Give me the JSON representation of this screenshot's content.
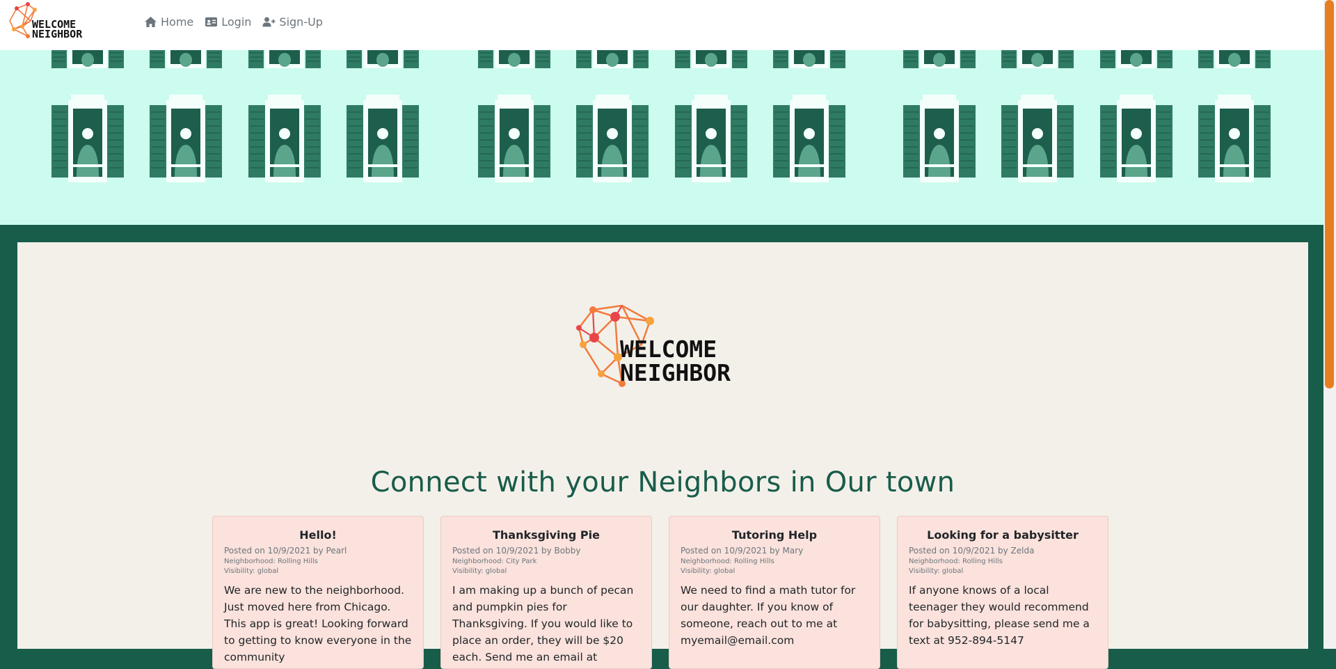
{
  "nav": {
    "logo_text": [
      "WELCOME",
      "NEIGHBOR"
    ],
    "links": [
      {
        "label": "Home",
        "icon": "home-icon"
      },
      {
        "label": "Login",
        "icon": "id-card-icon"
      },
      {
        "label": "Sign-Up",
        "icon": "user-plus-icon"
      }
    ]
  },
  "main": {
    "logo_text": [
      "WELCOME",
      "NEIGHBOR"
    ],
    "headline": "Connect with your Neighbors in Our town",
    "posts": [
      {
        "title": "Hello!",
        "posted": "Posted on 10/9/2021 by Pearl",
        "neighborhood": "Neighborhood: Rolling Hills",
        "visibility": "Visibility: global",
        "body": "We are new to the neighborhood. Just moved here from Chicago. This app is great! Looking forward to getting to know everyone in the community"
      },
      {
        "title": "Thanksgiving Pie",
        "posted": "Posted on 10/9/2021 by Bobby",
        "neighborhood": "Neighborhood: City Park",
        "visibility": "Visibility: global",
        "body": "I am making up a bunch of pecan and pumpkin pies for Thanksgiving. If you would like to place an order, they will be $20 each. Send me an email at"
      },
      {
        "title": "Tutoring Help",
        "posted": "Posted on 10/9/2021 by Mary",
        "neighborhood": "Neighborhood: Rolling Hills",
        "visibility": "Visibility: global",
        "body": "We need to find a math tutor for our daughter. If you know of someone, reach out to me at myemail@email.com"
      },
      {
        "title": "Looking for a babysitter",
        "posted": "Posted on 10/9/2021 by Zelda",
        "neighborhood": "Neighborhood: Rolling Hills",
        "visibility": "Visibility: global",
        "body": "If anyone knows of a local teenager they would recommend for babysitting, please send me a text at 952-894-5147"
      }
    ]
  },
  "colors": {
    "accent_green": "#185c4a",
    "hero_bg": "#ccfbef",
    "panel_bg": "#f3f0ea",
    "card_bg": "#fbe2dc",
    "logo_red": "#e8454a",
    "logo_orange": "#f7a23c",
    "scroll_thumb": "#e67e22"
  }
}
